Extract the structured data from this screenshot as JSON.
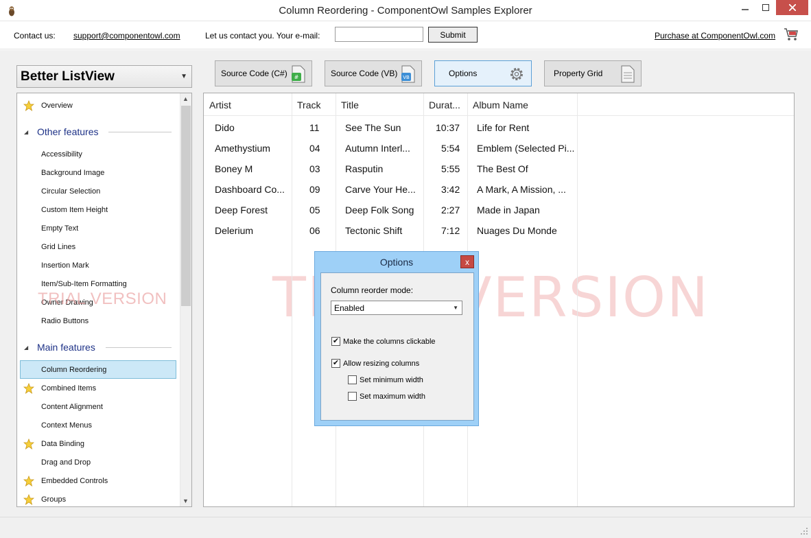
{
  "window": {
    "title": "Column Reordering - ComponentOwl Samples Explorer"
  },
  "contact": {
    "contact_label": "Contact us:",
    "support_email": "support@componentowl.com",
    "email_prompt": "Let us contact you. Your e-mail:",
    "email_value": "",
    "submit_label": "Submit",
    "purchase_link": "Purchase at ComponentOwl.com"
  },
  "product_select": {
    "value": "Better ListView"
  },
  "toolbar": {
    "buttons": [
      {
        "label": "Source Code (C#)"
      },
      {
        "label": "Source Code (VB)"
      },
      {
        "label": "Options"
      },
      {
        "label": "Property Grid"
      }
    ]
  },
  "nav": {
    "overview": "Overview",
    "other_group": "Other features",
    "other_items": [
      "Accessibility",
      "Background Image",
      "Circular Selection",
      "Custom Item Height",
      "Empty Text",
      "Grid Lines",
      "Insertion Mark",
      "Item/Sub-Item Formatting",
      "Owner Drawing",
      "Radio Buttons"
    ],
    "main_group": "Main features",
    "main_items": [
      "Column Reordering",
      "Combined Items",
      "Content Alignment",
      "Context Menus",
      "Data Binding",
      "Drag and Drop",
      "Embedded Controls",
      "Groups"
    ],
    "selected": "Column Reordering"
  },
  "watermark": {
    "small": "TRIAL VERSION",
    "big": "TRIAL VERSION"
  },
  "list": {
    "columns": [
      "Artist",
      "Track",
      "Title",
      "Durat...",
      "Album Name"
    ],
    "rows": [
      [
        "Dido",
        "11",
        "See The Sun",
        "10:37",
        "Life for Rent"
      ],
      [
        "Amethystium",
        "04",
        "Autumn Interl...",
        "5:54",
        "Emblem (Selected Pi..."
      ],
      [
        "Boney M",
        "03",
        "Rasputin",
        "5:55",
        "The Best Of"
      ],
      [
        "Dashboard Co...",
        "09",
        "Carve Your He...",
        "3:42",
        "A Mark, A Mission, ..."
      ],
      [
        "Deep Forest",
        "05",
        "Deep Folk Song",
        "2:27",
        "Made in Japan"
      ],
      [
        "Delerium",
        "06",
        "Tectonic Shift",
        "7:12",
        "Nuages Du Monde"
      ]
    ]
  },
  "options_dialog": {
    "title": "Options",
    "close": "x",
    "mode_label": "Column reorder mode:",
    "mode_value": "Enabled",
    "checks": [
      {
        "label": "Make the columns clickable",
        "checked": true
      },
      {
        "label": "Allow resizing columns",
        "checked": true
      },
      {
        "label": "Set minimum width",
        "checked": false
      },
      {
        "label": "Set maximum width",
        "checked": false
      }
    ]
  },
  "colors": {
    "accent": "#1e3287",
    "selection": "#cce8f7",
    "dialog": "#9ed0f7",
    "close_red": "#c7504b",
    "watermark": "#ec9696"
  }
}
